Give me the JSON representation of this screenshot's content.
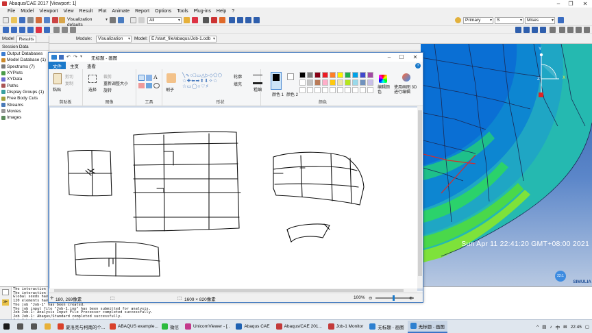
{
  "abaqus": {
    "title": "Abaqus/CAE 2017 [Viewport: 1]",
    "menu": [
      "File",
      "Model",
      "Viewport",
      "View",
      "Result",
      "Plot",
      "Animate",
      "Report",
      "Options",
      "Tools",
      "Plug-ins",
      "Help",
      "?"
    ],
    "toolbar": {
      "visualization_defaults": "Visualization defaults",
      "selection_filter": "All",
      "primary": "Primary",
      "variable_value": "S",
      "invariant": "Mises"
    },
    "module_row": {
      "model_tab": "Model",
      "results_tab": "Results",
      "module_label": "Module:",
      "module_value": "Visualization",
      "model_label": "Model:",
      "model_value": "E:/start_file/abaqus/Job-1.odb"
    },
    "tree": {
      "tabs": [
        "Model",
        "Results"
      ],
      "header": "Session Data",
      "items": [
        {
          "label": "Output Databases",
          "color": "#3c7dd1"
        },
        {
          "label": "Model Database (1)",
          "color": "#cc8a2a"
        },
        {
          "label": "Spectrums (7)",
          "color": "#7a7a7a"
        },
        {
          "label": "XYPlots",
          "color": "#4a9b4a"
        },
        {
          "label": "XYData",
          "color": "#6b6bd1"
        },
        {
          "label": "Paths",
          "color": "#aa5555"
        },
        {
          "label": "Display Groups (1)",
          "color": "#3aa0a0"
        },
        {
          "label": "Free Body Cuts",
          "color": "#a0a03a"
        },
        {
          "label": "Streams",
          "color": "#4a7ab8"
        },
        {
          "label": "Movies",
          "color": "#999999"
        },
        {
          "label": "Images",
          "color": "#5c8a5c"
        }
      ]
    },
    "viewport": {
      "date_text": "Sun Apr 11 22:41:20 GMT+08:00 2021",
      "logo": "SIMULIA",
      "axis_x": "X",
      "axis_y": "Y",
      "axis_z": "Z",
      "badge": "22:1"
    },
    "messages": [
      "The interaction p",
      "The interaction p",
      "Global seeds have",
      "120 elements have",
      "The job \"Job-1\" has been created.",
      "The job input file \"Job-1.inp\" has been submitted for analysis.",
      "Job Job-1: Analysis Input File Processor completed successfully.",
      "Job Job-1: Abaqus/Standard completed successfully.",
      "Job Job-1 completed successfully."
    ]
  },
  "paint": {
    "title": "无标题 - 画图",
    "tabs": [
      "文件",
      "主页",
      "查看"
    ],
    "groups": {
      "clipboard": {
        "label": "剪贴板",
        "paste": "粘贴",
        "cut": "剪切",
        "copy": "复制"
      },
      "image": {
        "label": "图像",
        "select": "选择",
        "crop": "裁剪",
        "resize": "重新调整大小",
        "rotate": "旋转"
      },
      "tools": {
        "label": "工具"
      },
      "brushes": {
        "label": "刷子"
      },
      "shapes": {
        "label": "形状",
        "outline": "轮廓",
        "fill": "填充"
      },
      "size": {
        "label": "粗细"
      },
      "colors": {
        "label": "颜色",
        "color1": "颜色 1",
        "color2": "颜色 2",
        "edit": "编辑颜色",
        "paint3d": "使用画图 3D 进行编辑",
        "palette": [
          "#000000",
          "#7f7f7f",
          "#880015",
          "#ed1c24",
          "#ff7f27",
          "#fff200",
          "#22b14c",
          "#00a2e8",
          "#3f48cc",
          "#a349a4",
          "#ffffff",
          "#c3c3c3",
          "#b97a57",
          "#ffaec9",
          "#ffc90e",
          "#efe4b0",
          "#b5e61d",
          "#99d9ea",
          "#7092be",
          "#c8bfe7"
        ]
      }
    },
    "status": {
      "cursor": "180, 269像素",
      "canvas_size": "1609 × 820像素",
      "zoom": "100%"
    }
  },
  "taskbar": {
    "items": [
      {
        "label": "",
        "name": "start-button",
        "color": "#1a1a1a"
      },
      {
        "label": "",
        "name": "search-button",
        "color": "#555555"
      },
      {
        "label": "",
        "name": "taskview-button",
        "color": "#555555"
      },
      {
        "label": "",
        "name": "explorer-button",
        "color": "#e8b13a"
      },
      {
        "label": "夏洛克与柯南的个...",
        "name": "task-browser",
        "color": "#d9412b"
      },
      {
        "label": "ABAQUS example...",
        "name": "task-abaqus-example",
        "color": "#d9412b"
      },
      {
        "label": "微信",
        "name": "task-wechat",
        "color": "#2dbb3d"
      },
      {
        "label": "UnicornViewer - [..",
        "name": "task-unicorn",
        "color": "#c43a8c"
      },
      {
        "label": "Abaqus CAE",
        "name": "task-abaqus-cae",
        "color": "#1f62b3"
      },
      {
        "label": "Abaqus/CAE 201...",
        "name": "task-abaqus-main",
        "color": "#c33a3a"
      },
      {
        "label": "Job-1 Monitor",
        "name": "task-job-monitor",
        "color": "#c33a3a"
      },
      {
        "label": "无标题 - 画图",
        "name": "task-paint-1",
        "color": "#2d80d0"
      },
      {
        "label": "无标题 - 画图",
        "name": "task-paint-2",
        "color": "#2d80d0"
      }
    ],
    "tray": {
      "ime": "中",
      "time": "22:45"
    }
  }
}
